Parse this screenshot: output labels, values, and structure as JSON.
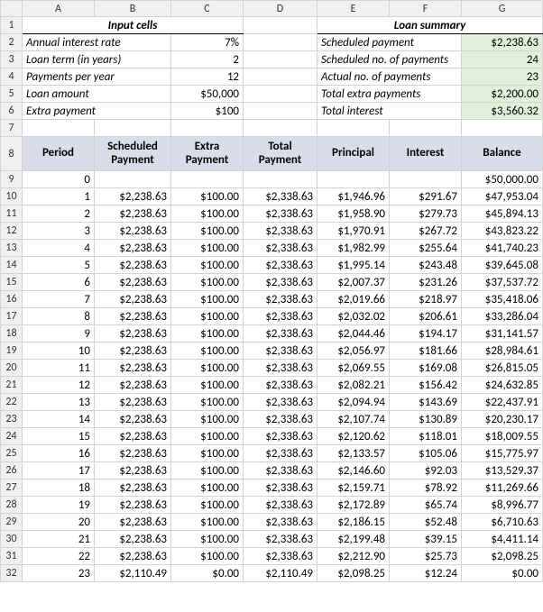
{
  "columns": [
    "A",
    "B",
    "C",
    "D",
    "E",
    "F",
    "G"
  ],
  "input_section_title": "Input cells",
  "summary_section_title": "Loan summary",
  "inputs": [
    {
      "label": "Annual interest rate",
      "value": "7%"
    },
    {
      "label": "Loan term (in years)",
      "value": "2"
    },
    {
      "label": "Payments per year",
      "value": "12"
    },
    {
      "label": "Loan amount",
      "value": "$50,000"
    },
    {
      "label": "Extra payment",
      "value": "$100"
    }
  ],
  "summary": [
    {
      "label": "Scheduled payment",
      "value": "$2,238.63",
      "highlight": true
    },
    {
      "label": "Scheduled no. of payments",
      "value": "24",
      "highlight": true
    },
    {
      "label": "Actual no. of payments",
      "value": "23",
      "highlight": true
    },
    {
      "label": "Total extra payments",
      "value": "$2,200.00",
      "highlight": true
    },
    {
      "label": "Total interest",
      "value": "$3,560.32",
      "highlight": true
    }
  ],
  "headers": [
    "Period",
    "Scheduled Payment",
    "Extra Payment",
    "Total Payment",
    "Principal",
    "Interest",
    "Balance"
  ],
  "chart_data": {
    "type": "table",
    "columns": [
      "Period",
      "Scheduled Payment",
      "Extra Payment",
      "Total Payment",
      "Principal",
      "Interest",
      "Balance"
    ],
    "rows": [
      {
        "period": 0,
        "scheduled": "",
        "extra": "",
        "total": "",
        "principal": "",
        "interest": "",
        "balance": "$50,000.00"
      },
      {
        "period": 1,
        "scheduled": "$2,238.63",
        "extra": "$100.00",
        "total": "$2,338.63",
        "principal": "$1,946.96",
        "interest": "$291.67",
        "balance": "$47,953.04"
      },
      {
        "period": 2,
        "scheduled": "$2,238.63",
        "extra": "$100.00",
        "total": "$2,338.63",
        "principal": "$1,958.90",
        "interest": "$279.73",
        "balance": "$45,894.13"
      },
      {
        "period": 3,
        "scheduled": "$2,238.63",
        "extra": "$100.00",
        "total": "$2,338.63",
        "principal": "$1,970.91",
        "interest": "$267.72",
        "balance": "$43,823.22"
      },
      {
        "period": 4,
        "scheduled": "$2,238.63",
        "extra": "$100.00",
        "total": "$2,338.63",
        "principal": "$1,982.99",
        "interest": "$255.64",
        "balance": "$41,740.23"
      },
      {
        "period": 5,
        "scheduled": "$2,238.63",
        "extra": "$100.00",
        "total": "$2,338.63",
        "principal": "$1,995.14",
        "interest": "$243.48",
        "balance": "$39,645.08"
      },
      {
        "period": 6,
        "scheduled": "$2,238.63",
        "extra": "$100.00",
        "total": "$2,338.63",
        "principal": "$2,007.37",
        "interest": "$231.26",
        "balance": "$37,537.72"
      },
      {
        "period": 7,
        "scheduled": "$2,238.63",
        "extra": "$100.00",
        "total": "$2,338.63",
        "principal": "$2,019.66",
        "interest": "$218.97",
        "balance": "$35,418.06"
      },
      {
        "period": 8,
        "scheduled": "$2,238.63",
        "extra": "$100.00",
        "total": "$2,338.63",
        "principal": "$2,032.02",
        "interest": "$206.61",
        "balance": "$33,286.04"
      },
      {
        "period": 9,
        "scheduled": "$2,238.63",
        "extra": "$100.00",
        "total": "$2,338.63",
        "principal": "$2,044.46",
        "interest": "$194.17",
        "balance": "$31,141.57"
      },
      {
        "period": 10,
        "scheduled": "$2,238.63",
        "extra": "$100.00",
        "total": "$2,338.63",
        "principal": "$2,056.97",
        "interest": "$181.66",
        "balance": "$28,984.61"
      },
      {
        "period": 11,
        "scheduled": "$2,238.63",
        "extra": "$100.00",
        "total": "$2,338.63",
        "principal": "$2,069.55",
        "interest": "$169.08",
        "balance": "$26,815.05"
      },
      {
        "period": 12,
        "scheduled": "$2,238.63",
        "extra": "$100.00",
        "total": "$2,338.63",
        "principal": "$2,082.21",
        "interest": "$156.42",
        "balance": "$24,632.85"
      },
      {
        "period": 13,
        "scheduled": "$2,238.63",
        "extra": "$100.00",
        "total": "$2,338.63",
        "principal": "$2,094.94",
        "interest": "$143.69",
        "balance": "$22,437.91"
      },
      {
        "period": 14,
        "scheduled": "$2,238.63",
        "extra": "$100.00",
        "total": "$2,338.63",
        "principal": "$2,107.74",
        "interest": "$130.89",
        "balance": "$20,230.17"
      },
      {
        "period": 15,
        "scheduled": "$2,238.63",
        "extra": "$100.00",
        "total": "$2,338.63",
        "principal": "$2,120.62",
        "interest": "$118.01",
        "balance": "$18,009.55"
      },
      {
        "period": 16,
        "scheduled": "$2,238.63",
        "extra": "$100.00",
        "total": "$2,338.63",
        "principal": "$2,133.57",
        "interest": "$105.06",
        "balance": "$15,775.97"
      },
      {
        "period": 17,
        "scheduled": "$2,238.63",
        "extra": "$100.00",
        "total": "$2,338.63",
        "principal": "$2,146.60",
        "interest": "$92.03",
        "balance": "$13,529.37"
      },
      {
        "period": 18,
        "scheduled": "$2,238.63",
        "extra": "$100.00",
        "total": "$2,338.63",
        "principal": "$2,159.71",
        "interest": "$78.92",
        "balance": "$11,269.66"
      },
      {
        "period": 19,
        "scheduled": "$2,238.63",
        "extra": "$100.00",
        "total": "$2,338.63",
        "principal": "$2,172.89",
        "interest": "$65.74",
        "balance": "$8,996.77"
      },
      {
        "period": 20,
        "scheduled": "$2,238.63",
        "extra": "$100.00",
        "total": "$2,338.63",
        "principal": "$2,186.15",
        "interest": "$52.48",
        "balance": "$6,710.63"
      },
      {
        "period": 21,
        "scheduled": "$2,238.63",
        "extra": "$100.00",
        "total": "$2,338.63",
        "principal": "$2,199.48",
        "interest": "$39.15",
        "balance": "$4,411.14"
      },
      {
        "period": 22,
        "scheduled": "$2,238.63",
        "extra": "$100.00",
        "total": "$2,338.63",
        "principal": "$2,212.90",
        "interest": "$25.73",
        "balance": "$2,098.25"
      },
      {
        "period": 23,
        "scheduled": "$2,110.49",
        "extra": "$0.00",
        "total": "$2,110.49",
        "principal": "$2,098.25",
        "interest": "$12.24",
        "balance": "$0.00"
      }
    ]
  }
}
